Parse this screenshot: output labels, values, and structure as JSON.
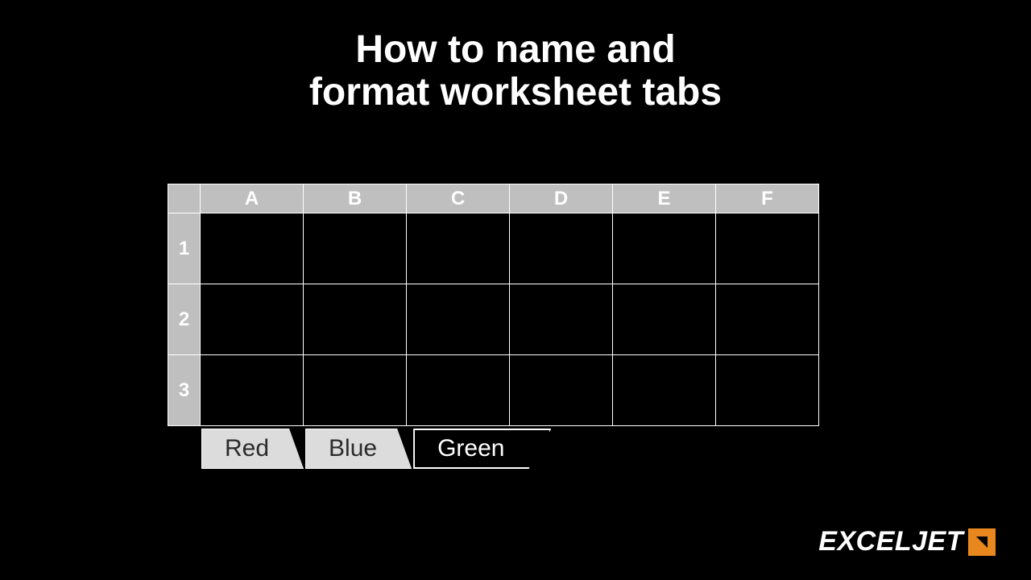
{
  "title_line1": "How to name and",
  "title_line2": "format worksheet tabs",
  "columns": [
    "A",
    "B",
    "C",
    "D",
    "E",
    "F"
  ],
  "rows": [
    "1",
    "2",
    "3"
  ],
  "tabs": [
    {
      "label": "Red",
      "active": false
    },
    {
      "label": "Blue",
      "active": false
    },
    {
      "label": "Green",
      "active": true
    }
  ],
  "brand": "EXCELJET"
}
